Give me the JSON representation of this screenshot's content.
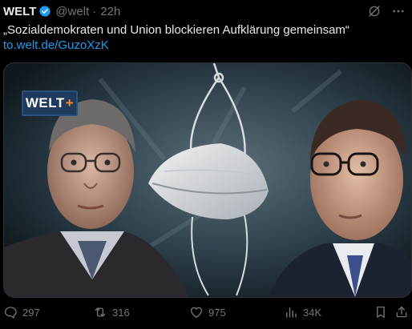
{
  "author": {
    "name": "WELT",
    "handle": "@welt",
    "separator": "·",
    "time": "22h"
  },
  "tweet": {
    "text": "„Sozialdemokraten und Union blockieren Aufklärung gemeinsam“",
    "link": "to.welt.de/GuzoXzK"
  },
  "media": {
    "logo_main": "WELT",
    "logo_plus": "+"
  },
  "actions": {
    "replies": "297",
    "reposts": "316",
    "likes": "975",
    "views": "34K"
  },
  "colors": {
    "background": "#000000",
    "text": "#e7e9ea",
    "muted": "#71767b",
    "link": "#1d9bf0",
    "verified": "#1d9bf0"
  }
}
